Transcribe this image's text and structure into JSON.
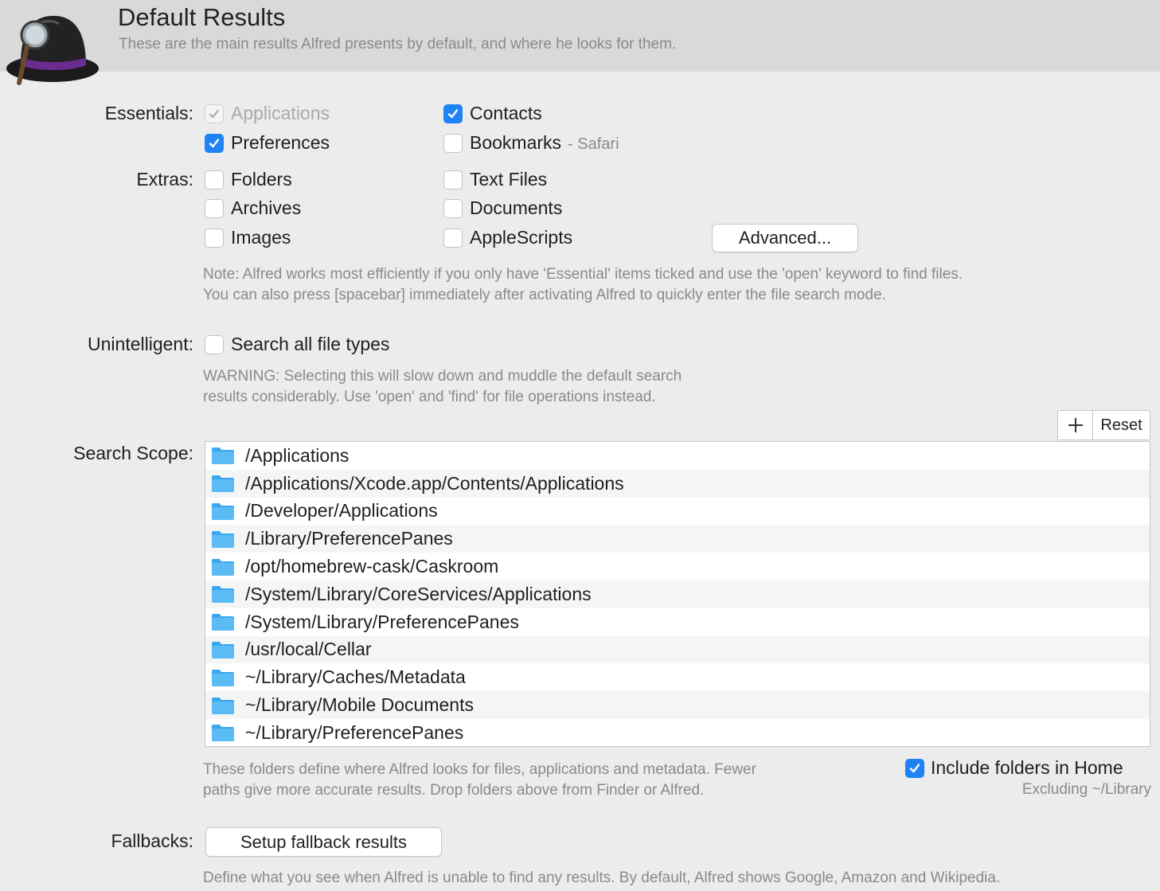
{
  "header": {
    "title": "Default Results",
    "subtitle": "These are the main results Alfred presents by default, and where he looks for them."
  },
  "essentials": {
    "label": "Essentials:",
    "applications": {
      "label": "Applications",
      "checked": true,
      "disabled": true
    },
    "contacts": {
      "label": "Contacts",
      "checked": true
    },
    "preferences": {
      "label": "Preferences",
      "checked": true
    },
    "bookmarks": {
      "label": "Bookmarks",
      "sub": "- Safari",
      "checked": false
    }
  },
  "extras": {
    "label": "Extras:",
    "folders": {
      "label": "Folders",
      "checked": false
    },
    "text_files": {
      "label": "Text Files",
      "checked": false
    },
    "archives": {
      "label": "Archives",
      "checked": false
    },
    "documents": {
      "label": "Documents",
      "checked": false
    },
    "images": {
      "label": "Images",
      "checked": false
    },
    "applescripts": {
      "label": "AppleScripts",
      "checked": false
    },
    "advanced_button": "Advanced..."
  },
  "note": {
    "line1": "Note: Alfred works most efficiently if you only have 'Essential' items ticked and use the 'open' keyword to find files.",
    "line2": "You can also press [spacebar] immediately after activating Alfred to quickly enter the file search mode."
  },
  "unintelligent": {
    "label": "Unintelligent:",
    "option": {
      "label": "Search all file types",
      "checked": false
    },
    "warning_line1": "WARNING: Selecting this will slow down and muddle the default search",
    "warning_line2": "results considerably. Use 'open' and 'find' for file operations instead."
  },
  "search_scope": {
    "label": "Search Scope:",
    "reset_button": "Reset",
    "paths": [
      "/Applications",
      "/Applications/Xcode.app/Contents/Applications",
      "/Developer/Applications",
      "/Library/PreferencePanes",
      "/opt/homebrew-cask/Caskroom",
      "/System/Library/CoreServices/Applications",
      "/System/Library/PreferencePanes",
      "/usr/local/Cellar",
      "~/Library/Caches/Metadata",
      "~/Library/Mobile Documents",
      "~/Library/PreferencePanes"
    ],
    "description_line1": "These folders define where Alfred looks for files, applications and metadata. Fewer",
    "description_line2": "paths give more accurate results. Drop folders above from Finder or Alfred.",
    "include_home": {
      "label": "Include folders in Home",
      "sub": "Excluding ~/Library",
      "checked": true
    }
  },
  "fallbacks": {
    "label": "Fallbacks:",
    "button": "Setup fallback results",
    "description": "Define what you see when Alfred is unable to find any results. By default, Alfred shows Google, Amazon and Wikipedia."
  },
  "colors": {
    "accent": "#1f82f5",
    "folder": "#3aa7ee",
    "header_bg": "#d9d9d9",
    "panel_bg": "#ececec"
  },
  "icons": [
    "alfred-hat-logo",
    "checkmark-icon",
    "plus-icon",
    "folder-icon"
  ]
}
